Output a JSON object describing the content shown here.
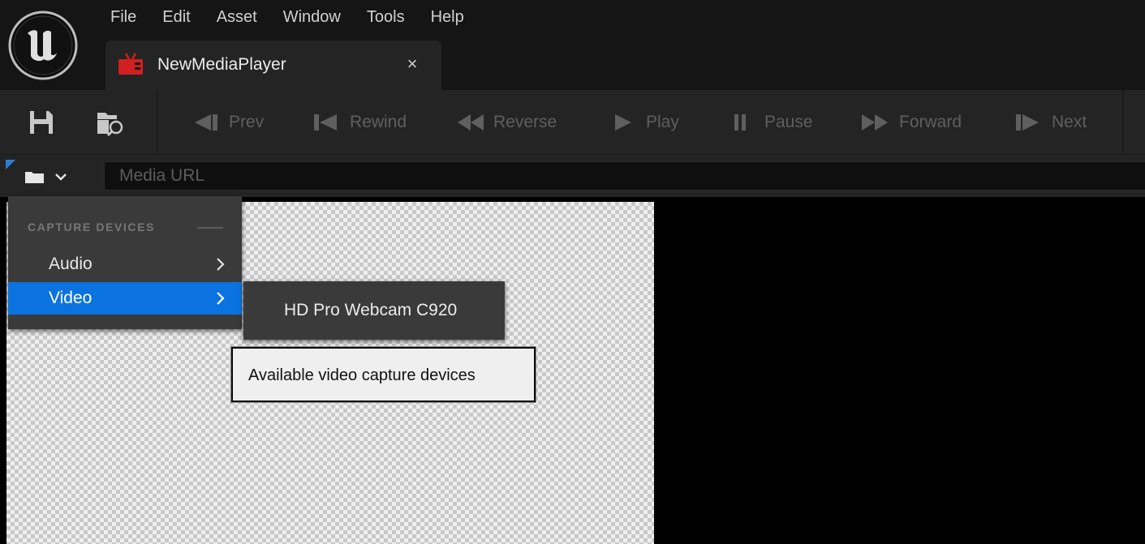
{
  "menu": {
    "items": [
      "File",
      "Edit",
      "Asset",
      "Window",
      "Tools",
      "Help"
    ]
  },
  "tab": {
    "title": "NewMediaPlayer",
    "close_glyph": "×",
    "icon": "media-player-tv-icon"
  },
  "toolbar": {
    "save_icon": "save-icon",
    "browse_icon": "browse-asset-icon",
    "buttons": [
      {
        "label": "Prev",
        "icon": "prev-icon"
      },
      {
        "label": "Rewind",
        "icon": "rewind-icon"
      },
      {
        "label": "Reverse",
        "icon": "reverse-icon"
      },
      {
        "label": "Play",
        "icon": "play-icon"
      },
      {
        "label": "Pause",
        "icon": "pause-icon"
      },
      {
        "label": "Forward",
        "icon": "forward-icon"
      },
      {
        "label": "Next",
        "icon": "next-icon"
      }
    ]
  },
  "urlbar": {
    "placeholder": "Media URL",
    "value": ""
  },
  "dropdown": {
    "header": "CAPTURE DEVICES",
    "items": [
      {
        "label": "Audio",
        "active": false
      },
      {
        "label": "Video",
        "active": true
      }
    ]
  },
  "submenu": {
    "items": [
      "HD Pro Webcam C920"
    ]
  },
  "tooltip": {
    "text": "Available video capture devices"
  },
  "colors": {
    "accent": "#0b73e0",
    "background": "#151515",
    "panel": "#242424",
    "disabled_text": "#5f5f5f",
    "tab_icon_red": "#d21f1f"
  }
}
